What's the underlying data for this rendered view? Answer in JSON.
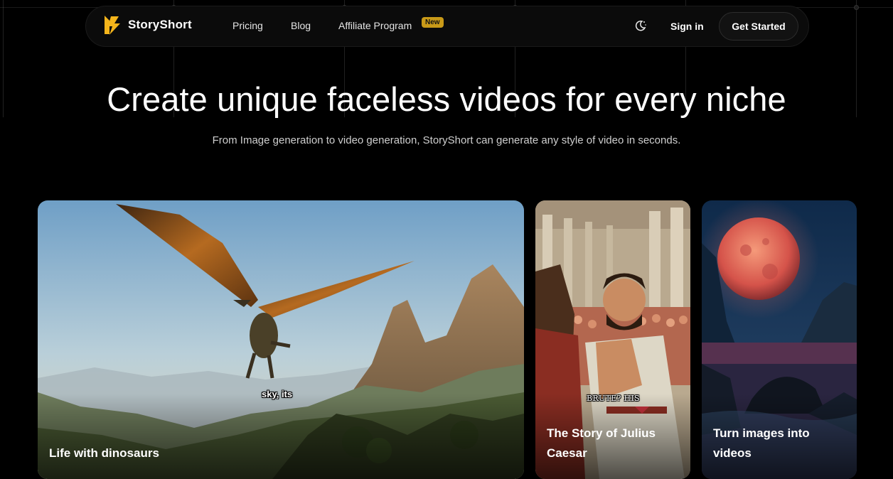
{
  "nav": {
    "brand": "StoryShort",
    "links": [
      "Pricing",
      "Blog",
      "Affiliate Program"
    ],
    "badge": "New",
    "theme_icon": "moon-sun-icon",
    "sign_in": "Sign in",
    "cta": "Get Started"
  },
  "hero": {
    "title": "Create unique faceless videos for every niche",
    "subtitle": "From Image generation to video generation, StoryShort can generate any style of video in seconds."
  },
  "cards": [
    {
      "label": "Life with dinosaurs",
      "caption": "sky, its"
    },
    {
      "label": "The Story of Julius Caesar",
      "caption": "BRUTE? HIS"
    },
    {
      "label": "Turn images into videos",
      "caption": ""
    }
  ],
  "colors": {
    "background": "#000000",
    "badge": "#c99a18",
    "logo_accent": "#f5b51b"
  }
}
